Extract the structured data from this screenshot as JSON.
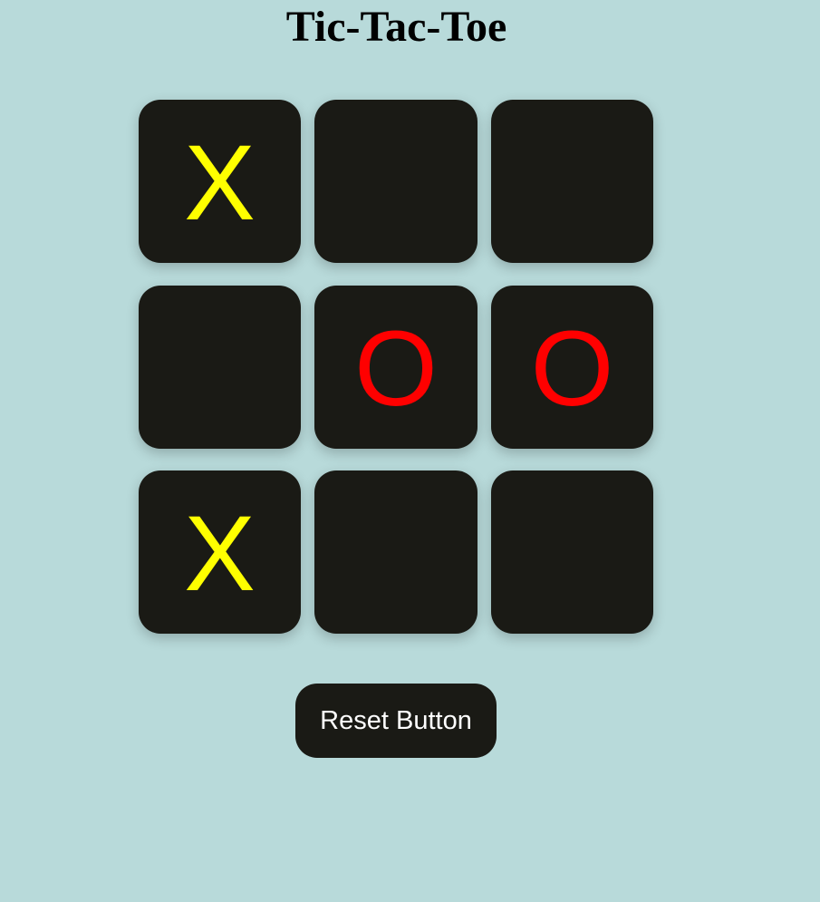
{
  "title": "Tic-Tac-Toe",
  "board": {
    "cells": [
      {
        "mark": "X",
        "player": "x"
      },
      {
        "mark": "",
        "player": "empty"
      },
      {
        "mark": "",
        "player": "empty"
      },
      {
        "mark": "",
        "player": "empty"
      },
      {
        "mark": "O",
        "player": "o"
      },
      {
        "mark": "O",
        "player": "o"
      },
      {
        "mark": "X",
        "player": "x"
      },
      {
        "mark": "",
        "player": "empty"
      },
      {
        "mark": "",
        "player": "empty"
      }
    ]
  },
  "reset_label": "Reset Button",
  "colors": {
    "background": "#b8dada",
    "cell": "#1a1a15",
    "x_mark": "#ffff00",
    "o_mark": "#ff0000",
    "button_text": "#ffffff"
  }
}
